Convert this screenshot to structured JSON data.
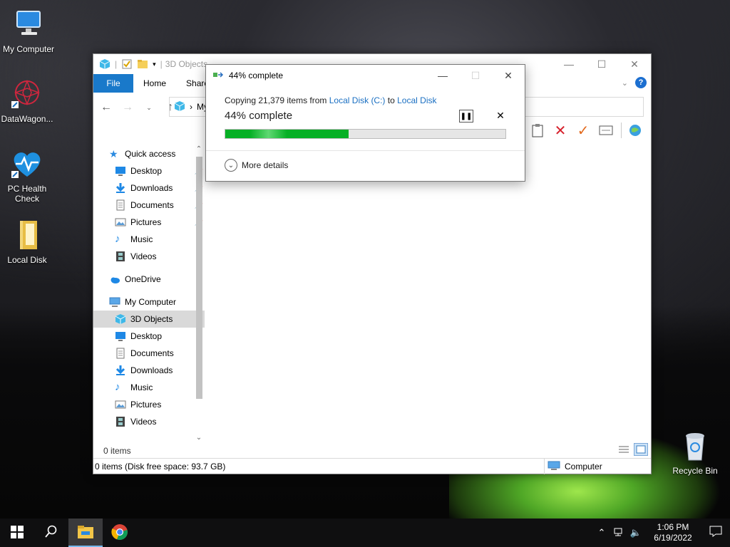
{
  "desktop": {
    "icons": [
      {
        "label": "My Computer"
      },
      {
        "label": "DataWagon..."
      },
      {
        "label": "PC Health Check"
      },
      {
        "label": "Local Disk"
      },
      {
        "label": "Recycle Bin"
      }
    ]
  },
  "explorer": {
    "title": "3D Objects",
    "ribbon_tabs": [
      "File",
      "Home",
      "Share"
    ],
    "address_text": "My",
    "nav": {
      "quick_access": "Quick access",
      "quick_items": [
        "Desktop",
        "Downloads",
        "Documents",
        "Pictures",
        "Music",
        "Videos"
      ],
      "onedrive": "OneDrive",
      "my_computer": "My Computer",
      "computer_items": [
        "3D Objects",
        "Desktop",
        "Documents",
        "Downloads",
        "Music",
        "Pictures",
        "Videos"
      ],
      "selected": "3D Objects"
    },
    "items_count": "0 items",
    "status_text": "0 items (Disk free space: 93.7 GB)",
    "status_location": "Computer"
  },
  "dialog": {
    "title": "44% complete",
    "copying_prefix": "Copying 21,379 items from ",
    "source": "Local Disk (C:)",
    "to_word": " to ",
    "destination": "Local Disk",
    "percent_text": "44% complete",
    "progress": 0.44,
    "more_details": "More details"
  },
  "taskbar": {
    "time": "1:06 PM",
    "date": "6/19/2022"
  },
  "colors": {
    "accent": "#1979ca",
    "progress": "#06b025",
    "link": "#1a6fc2"
  }
}
